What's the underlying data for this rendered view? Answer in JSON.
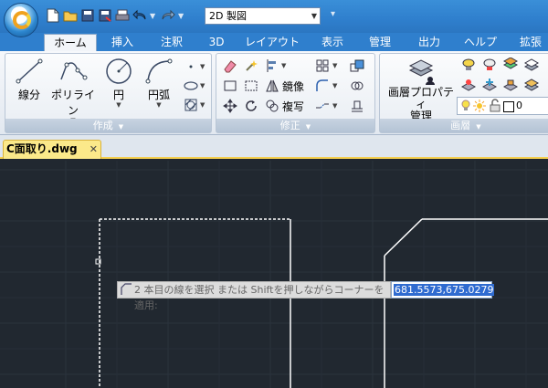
{
  "workspace": {
    "selected": "2D 製図"
  },
  "tabs": [
    "ホーム",
    "挿入",
    "注釈",
    "3D",
    "レイアウト",
    "表示",
    "管理",
    "出力",
    "ヘルプ",
    "拡張"
  ],
  "active_tab": "ホーム",
  "panels": {
    "create": {
      "title": "作成",
      "buttons": [
        "線分",
        "ポリライン",
        "円",
        "円弧"
      ]
    },
    "modify": {
      "title": "修正",
      "mirror_label": "鏡像",
      "copy_label": "複写"
    },
    "layer": {
      "title": "画層",
      "properties_label_line1": "画層プロパティ",
      "properties_label_line2": "管理",
      "current_layer": "0"
    }
  },
  "document": {
    "tab_label": "C面取り.dwg"
  },
  "command": {
    "prompt": "2 本目の線を選択 または Shiftを押しながらコーナーを適用:",
    "coordinate_value": "681.5573,675.0279"
  }
}
